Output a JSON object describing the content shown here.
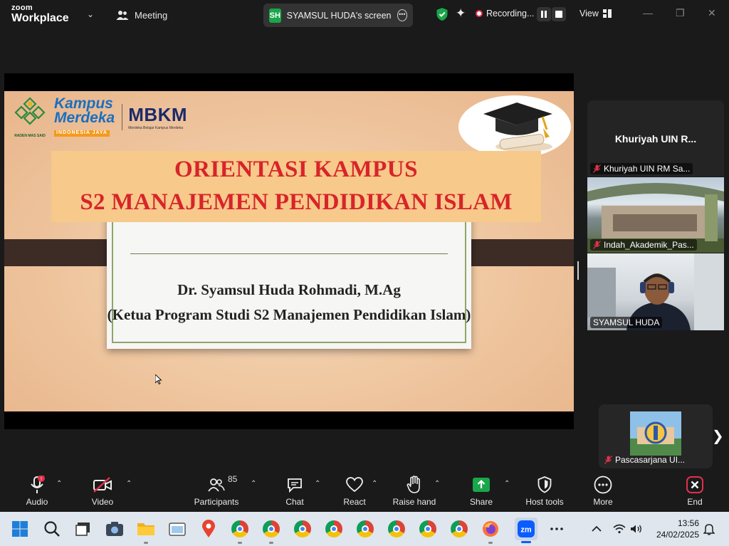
{
  "titlebar": {
    "brand_top": "zoom",
    "brand_bottom": "Workplace",
    "meeting_label": "Meeting",
    "share_avatar": "SH",
    "share_label": "SYAMSUL HUDA's screen",
    "recording_label": "Recording...",
    "view_label": "View"
  },
  "slide": {
    "title_line1": "ORIENTASI KAMPUS",
    "title_line2": "S2 MANAJEMEN PENDIDIKAN ISLAM",
    "presenter": "Dr. Syamsul Huda Rohmadi, M.Ag",
    "program": "(Ketua Program Studi S2 Manajemen Pendidikan Islam)",
    "logo_uin_caption": "RADEN MAS SAID",
    "logo_kampus": "Kampus",
    "logo_merdeka": "Merdeka",
    "logo_indonesia": "INDONESIA JAYA",
    "logo_mbkm": "MBKM",
    "logo_mbkm_sub": "Merdeka Belajar Kampus Merdeka"
  },
  "participants_panel": {
    "tile1_big": "Khuriyah UIN R...",
    "tile1_name": "Khuriyah UIN RM Sa...",
    "tile2_name": "Indah_Akademik_Pas...",
    "tile3_name": "SYAMSUL HUDA",
    "tile4_name": "Pascasarjana UI..."
  },
  "toolbar": {
    "audio": "Audio",
    "video": "Video",
    "participants": "Participants",
    "participants_count": "85",
    "chat": "Chat",
    "react": "React",
    "raise_hand": "Raise hand",
    "share": "Share",
    "host_tools": "Host tools",
    "more": "More",
    "end": "End"
  },
  "taskbar": {
    "time": "13:56",
    "date": "24/02/2025"
  },
  "colors": {
    "zoom_blue": "#0b5cff",
    "share_green": "#1aa64a",
    "end_red": "#e0314b",
    "title_red": "#d8242a"
  }
}
